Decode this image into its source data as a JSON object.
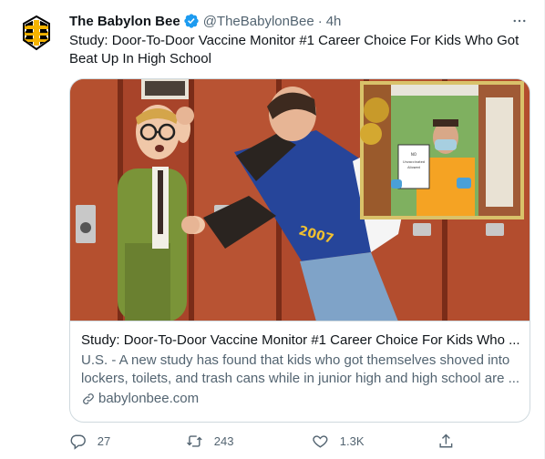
{
  "author": {
    "display_name": "The Babylon Bee",
    "handle": "@TheBabylonBee",
    "separator": "·",
    "time": "4h",
    "avatar_icon": "bee-logo-icon",
    "verified_color": "#1d9bf0"
  },
  "tweet": {
    "text": "Study: Door-To-Door Vaccine Monitor #1 Career Choice For Kids Who Got Beat Up In High School"
  },
  "card": {
    "image_icon": "article-image",
    "title": "Study: Door-To-Door Vaccine Monitor #1 Career Choice For Kids Who ...",
    "description": "U.S. - A new study has found that kids who got themselves shoved into lockers, toilets, and trash cans while in junior high and high school are ...",
    "domain": "babylonbee.com",
    "inset_sign_text": "NO\nUnvaccinated\nAllowed"
  },
  "actions": {
    "reply_count": "27",
    "retweet_count": "243",
    "like_count": "1.3K"
  },
  "colors": {
    "text_primary": "#0f1419",
    "text_secondary": "#536471",
    "border": "#cfd9de",
    "accent": "#1d9bf0"
  }
}
